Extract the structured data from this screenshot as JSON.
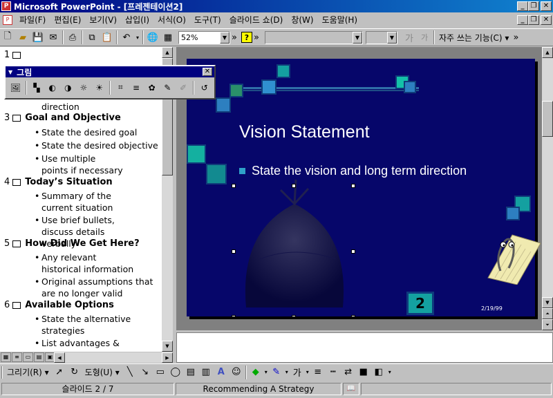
{
  "window": {
    "title": "Microsoft PowerPoint - [프레젠테이션2]",
    "app_icon": "powerpoint-icon",
    "controls": [
      "minimize",
      "restore",
      "close"
    ]
  },
  "menu": {
    "items": [
      "파일(F)",
      "편집(E)",
      "보기(V)",
      "삽입(I)",
      "서식(O)",
      "도구(T)",
      "슬라이드 쇼(D)",
      "창(W)",
      "도움말(H)"
    ]
  },
  "toolbar": {
    "zoom": "52%",
    "overflow": "»",
    "font_sample_1": "가",
    "font_sample_2": "가",
    "common_tasks": "자주 쓰는 기능(C) ▾"
  },
  "picture_toolbar": {
    "title": "그림",
    "close": "✕"
  },
  "outline": {
    "slides": [
      {
        "num": "1",
        "title": ""
      },
      {
        "num": "3",
        "title": "Goal and Objective",
        "bullets": [
          "State the desired goal",
          "State the desired objective",
          "Use multiple points if necessary"
        ]
      },
      {
        "num": "4",
        "title": "Today’s Situation",
        "bullets": [
          "Summary of the current situation",
          "Use brief bullets, discuss details verbally"
        ]
      },
      {
        "num": "5",
        "title": "How Did We Get Here?",
        "bullets": [
          "Any relevant historical information",
          "Original assumptions that are no longer valid"
        ]
      },
      {
        "num": "6",
        "title": "Available Options",
        "bullets": [
          "State the alternative strategies",
          "List advantages &"
        ]
      }
    ],
    "partial_text": "direction",
    "bullet_char": "•"
  },
  "slide": {
    "title": "Vision Statement",
    "bullet": "State the vision and long term direction",
    "number": "2",
    "date": "2/19/99"
  },
  "drawing_toolbar": {
    "draw_menu": "그리기(R) ▾",
    "autoshapes_menu": "도형(U) ▾"
  },
  "status": {
    "slide_pos": "슬라이드 2 / 7",
    "template": "Recommending A Strategy"
  },
  "colors": {
    "slide_bg": "#06066a",
    "accent_teal": "#14a0a0",
    "title_bar": "#000080"
  }
}
